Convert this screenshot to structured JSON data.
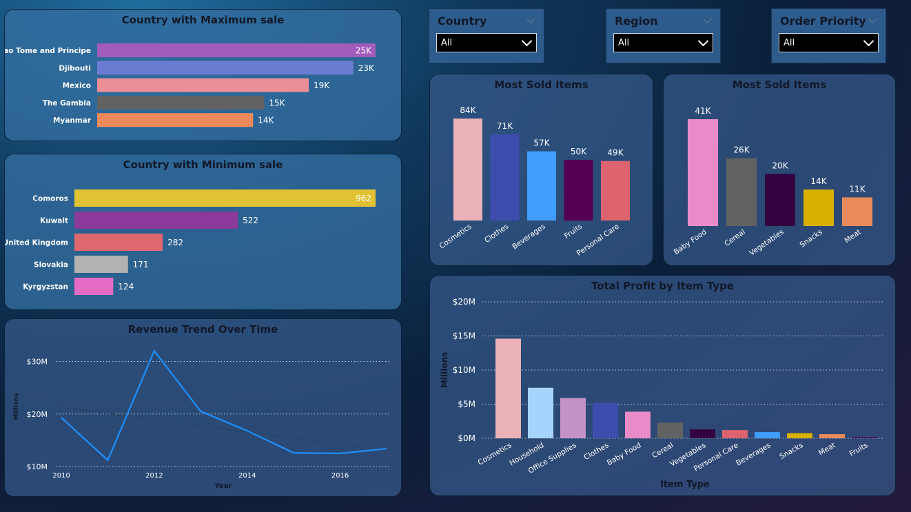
{
  "filters": [
    {
      "label": "Country",
      "value": "All"
    },
    {
      "label": "Region",
      "value": "All"
    },
    {
      "label": "Order Priority",
      "value": "All"
    }
  ],
  "chart_data": [
    {
      "id": "max_sale",
      "type": "bar",
      "orientation": "horizontal",
      "title": "Country with Maximum sale",
      "categories": [
        "Sao Tome and Principe",
        "Djibouti",
        "Mexico",
        "The Gambia",
        "Myanmar"
      ],
      "values": [
        25000,
        23000,
        19000,
        15000,
        14000
      ],
      "labels": [
        "25K",
        "23K",
        "19K",
        "15K",
        "14K"
      ],
      "colors": [
        "#a25dbb",
        "#6a7dd2",
        "#eb8e96",
        "#626262",
        "#ec8a5c"
      ]
    },
    {
      "id": "min_sale",
      "type": "bar",
      "orientation": "horizontal",
      "title": "Country with Minimum sale",
      "categories": [
        "Comoros",
        "Kuwait",
        "United Kingdom",
        "Slovakia",
        "Kyrgyzstan"
      ],
      "values": [
        962,
        522,
        282,
        171,
        124
      ],
      "labels": [
        "962",
        "522",
        "282",
        "171",
        "124"
      ],
      "colors": [
        "#e0c232",
        "#8b3a9c",
        "#df6870",
        "#b3b3b3",
        "#e56cc4"
      ]
    },
    {
      "id": "revenue_trend",
      "type": "line",
      "title": "Revenue Trend Over Time",
      "xlabel": "Year",
      "ylabel": "Millions",
      "x": [
        2010,
        2011,
        2012,
        2013,
        2014,
        2015,
        2016,
        2017
      ],
      "y": [
        19.3,
        11.2,
        32.0,
        20.5,
        16.8,
        12.6,
        12.5,
        13.4
      ],
      "trend": [
        21.3,
        13.1
      ],
      "xticks": [
        "2010",
        "2012",
        "2014",
        "2016"
      ],
      "yticks": [
        "$10M",
        "$20M",
        "$30M"
      ],
      "ylim": [
        10,
        34
      ]
    },
    {
      "id": "most_sold_1",
      "type": "bar",
      "title": "Most Sold Items",
      "categories": [
        "Cosmetics",
        "Clothes",
        "Beverages",
        "Fruits",
        "Personal Care"
      ],
      "values": [
        84000,
        71000,
        57000,
        50000,
        49000
      ],
      "labels": [
        "84K",
        "71K",
        "57K",
        "50K",
        "49K"
      ],
      "colors": [
        "#eab2b6",
        "#3e4dad",
        "#409dfb",
        "#540054",
        "#dd646e"
      ]
    },
    {
      "id": "most_sold_2",
      "type": "bar",
      "title": "Most Sold Items",
      "categories": [
        "Baby Food",
        "Cereal",
        "Vegetables",
        "Snacks",
        "Meat"
      ],
      "values": [
        41000,
        26000,
        20000,
        14000,
        11000
      ],
      "labels": [
        "41K",
        "26K",
        "20K",
        "14K",
        "11K"
      ],
      "colors": [
        "#e98bc8",
        "#626262",
        "#340040",
        "#d8b000",
        "#ea8a5a"
      ]
    },
    {
      "id": "total_profit",
      "type": "bar",
      "title": "Total Profit by Item Type",
      "xlabel": "Item Type",
      "ylabel": "Millions",
      "categories": [
        "Cosmetics",
        "Household",
        "Office Supplies",
        "Clothes",
        "Baby Food",
        "Cereal",
        "Vegetables",
        "Personal Care",
        "Beverages",
        "Snacks",
        "Meat",
        "Fruits"
      ],
      "values": [
        14.6,
        7.4,
        5.9,
        5.2,
        3.9,
        2.3,
        1.3,
        1.2,
        0.9,
        0.75,
        0.6,
        0.15
      ],
      "yticks": [
        "$0M",
        "$5M",
        "$10M",
        "$15M",
        "$20M"
      ],
      "ylim": [
        0,
        20
      ],
      "colors": [
        "#eab2b6",
        "#a7d4ff",
        "#c393c8",
        "#3e4dad",
        "#e98bc8",
        "#626262",
        "#340040",
        "#dd646e",
        "#409dfb",
        "#d8b000",
        "#ea8a5a",
        "#540054"
      ]
    }
  ]
}
